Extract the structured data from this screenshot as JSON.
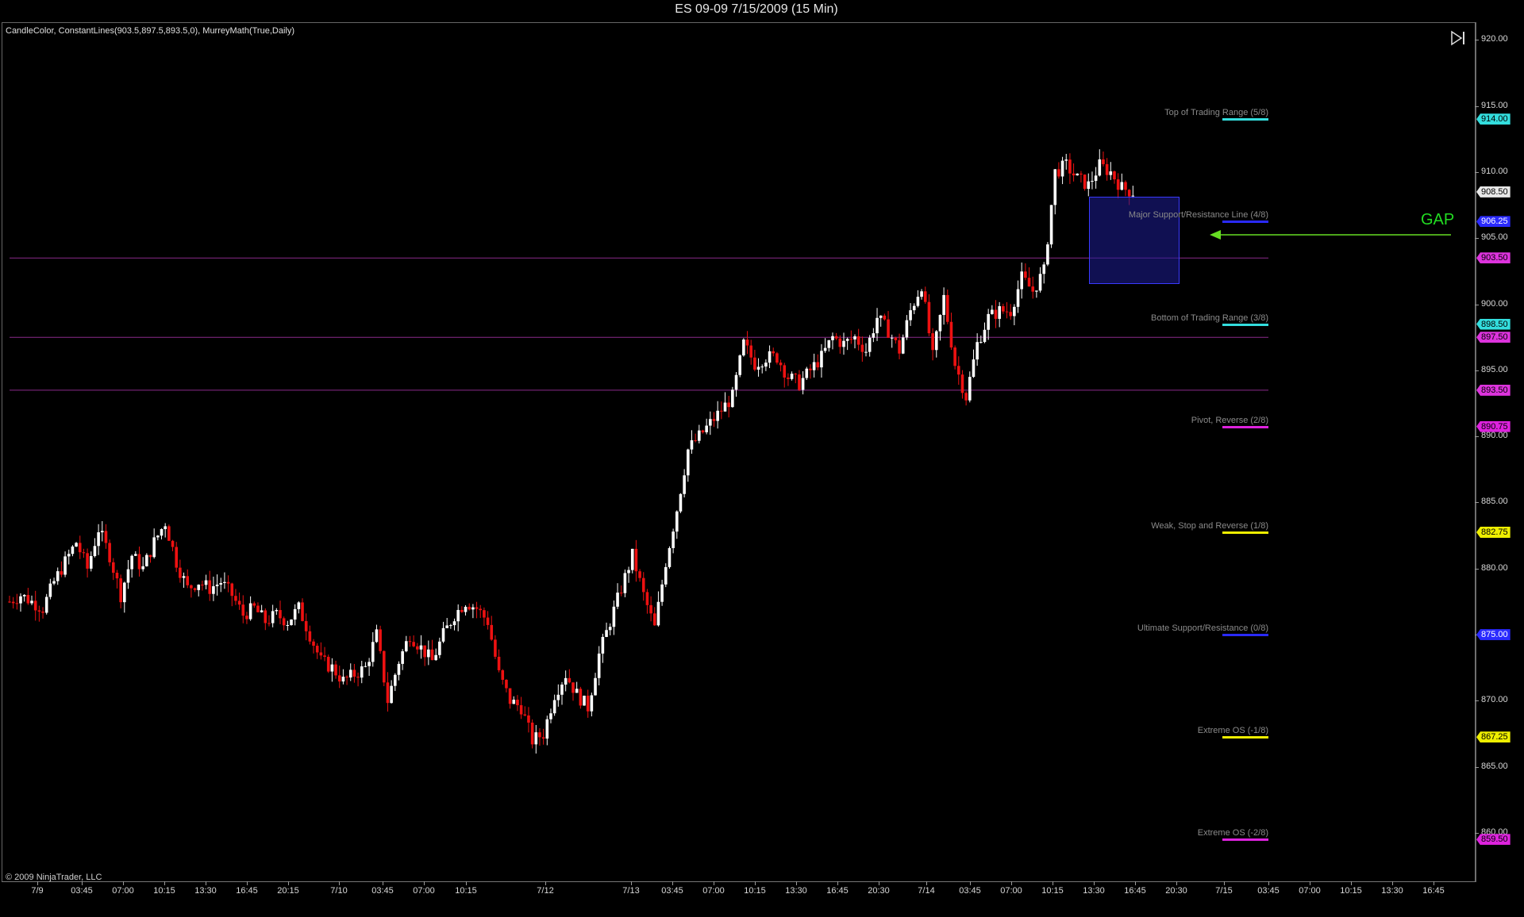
{
  "window": {
    "title": "ES 09-09  7/15/2009 (15 Min)",
    "indicators": "CandleColor, ConstantLines(903.5,897.5,893.5,0), MurreyMath(True,Daily)",
    "copyright": "© 2009 NinjaTrader, LLC",
    "gap_label": "GAP"
  },
  "icons": {
    "play_end": "skip-to-end-icon"
  },
  "colors": {
    "up_candle": "#ffffff",
    "down_candle": "#ee1111",
    "constant_line": "#8a2a8a",
    "gap_arrow": "#66dd22",
    "gap_text": "#22dd22",
    "gap_box": "#1e1e96"
  },
  "y_axis": {
    "labels": [
      "920.00",
      "915.00",
      "910.00",
      "905.00",
      "900.00",
      "895.00",
      "890.00",
      "885.00",
      "880.00",
      "875.00",
      "870.00",
      "865.00",
      "860.00"
    ],
    "range": [
      858.5,
      920.5
    ]
  },
  "x_axis": {
    "labels": [
      "7/9",
      "03:45",
      "07:00",
      "10:15",
      "13:30",
      "16:45",
      "20:15",
      "7/10",
      "03:45",
      "07:00",
      "10:15",
      "7/12",
      "7/13",
      "03:45",
      "07:00",
      "10:15",
      "13:30",
      "16:45",
      "20:30",
      "7/14",
      "03:45",
      "07:00",
      "10:15",
      "13:30",
      "16:45",
      "20:30",
      "7/15",
      "03:45",
      "07:00",
      "10:15",
      "13:30",
      "16:45"
    ]
  },
  "murrey_levels": [
    {
      "label": "Top of Trading Range (5/8)",
      "price": "914.00",
      "value": 914.0,
      "color": "#33dddd"
    },
    {
      "label": "Major Support/Resistance Line (4/8)",
      "price": "906.25",
      "value": 906.25,
      "color": "#2a2aff"
    },
    {
      "label": "Bottom of Trading Range (3/8)",
      "price": "898.50",
      "value": 898.5,
      "color": "#33dddd"
    },
    {
      "label": "Pivot, Reverse (2/8)",
      "price": "890.75",
      "value": 890.75,
      "color": "#dd22dd"
    },
    {
      "label": "Weak, Stop and Reverse (1/8)",
      "price": "882.75",
      "value": 882.75,
      "color": "#eeee00"
    },
    {
      "label": "Ultimate Support/Resistance (0/8)",
      "price": "875.00",
      "value": 875.0,
      "color": "#2a2aff"
    },
    {
      "label": "Extreme OS (-1/8)",
      "price": "867.25",
      "value": 867.25,
      "color": "#eeee00"
    },
    {
      "label": "Extreme OS (-2/8)",
      "price": "859.50",
      "value": 859.5,
      "color": "#dd22dd"
    }
  ],
  "constant_lines": [
    {
      "price": "903.50",
      "value": 903.5
    },
    {
      "price": "897.50",
      "value": 897.5
    },
    {
      "price": "893.50",
      "value": 893.5
    }
  ],
  "last_price": {
    "price": "908.50",
    "value": 908.5
  },
  "chart_data": {
    "type": "candlestick",
    "title": "ES 09-09  7/15/2009 (15 Min)",
    "ylim": [
      858.5,
      920.5
    ],
    "path_close": [
      [
        0,
        877.5
      ],
      [
        3,
        878.0
      ],
      [
        6,
        877.5
      ],
      [
        9,
        877.0
      ],
      [
        12,
        879.0
      ],
      [
        15,
        880.5
      ],
      [
        18,
        882.0
      ],
      [
        21,
        880.0
      ],
      [
        24,
        883.0
      ],
      [
        27,
        881.0
      ],
      [
        30,
        878.0
      ],
      [
        33,
        881.0
      ],
      [
        36,
        880.0
      ],
      [
        39,
        882.0
      ],
      [
        42,
        883.5
      ],
      [
        45,
        880.5
      ],
      [
        48,
        878.5
      ],
      [
        51,
        879.0
      ],
      [
        54,
        878.5
      ],
      [
        57,
        879.0
      ],
      [
        60,
        878.0
      ],
      [
        63,
        876.5
      ],
      [
        66,
        877.0
      ],
      [
        69,
        876.0
      ],
      [
        72,
        876.5
      ],
      [
        75,
        876.0
      ],
      [
        78,
        877.0
      ],
      [
        81,
        875.0
      ],
      [
        84,
        873.0
      ],
      [
        87,
        872.5
      ],
      [
        90,
        871.5
      ],
      [
        93,
        872.0
      ],
      [
        96,
        872.5
      ],
      [
        99,
        875.0
      ],
      [
        102,
        870.0
      ],
      [
        105,
        873.0
      ],
      [
        108,
        875.0
      ],
      [
        111,
        874.0
      ],
      [
        114,
        873.0
      ],
      [
        117,
        875.0
      ],
      [
        120,
        876.5
      ],
      [
        123,
        877.5
      ],
      [
        126,
        877.0
      ],
      [
        129,
        876.0
      ],
      [
        132,
        872.0
      ],
      [
        135,
        870.0
      ],
      [
        138,
        869.5
      ],
      [
        141,
        867.0
      ],
      [
        144,
        867.5
      ],
      [
        147,
        870.5
      ],
      [
        150,
        872.0
      ],
      [
        153,
        870.5
      ],
      [
        156,
        869.5
      ],
      [
        159,
        873.5
      ],
      [
        162,
        876.0
      ],
      [
        165,
        878.5
      ],
      [
        168,
        881.0
      ],
      [
        171,
        878.0
      ],
      [
        174,
        875.5
      ],
      [
        177,
        880.5
      ],
      [
        180,
        884.5
      ],
      [
        183,
        889.0
      ],
      [
        186,
        890.0
      ],
      [
        189,
        891.0
      ],
      [
        192,
        892.0
      ],
      [
        195,
        893.0
      ],
      [
        198,
        897.0
      ],
      [
        201,
        895.5
      ],
      [
        204,
        896.0
      ],
      [
        207,
        896.0
      ],
      [
        210,
        894.5
      ],
      [
        213,
        894.0
      ],
      [
        216,
        895.0
      ],
      [
        219,
        896.0
      ],
      [
        222,
        897.5
      ],
      [
        225,
        897.0
      ],
      [
        228,
        897.5
      ],
      [
        231,
        896.5
      ],
      [
        234,
        899.0
      ],
      [
        237,
        898.0
      ],
      [
        240,
        896.5
      ],
      [
        243,
        899.5
      ],
      [
        246,
        901.5
      ],
      [
        249,
        896.0
      ],
      [
        252,
        900.5
      ],
      [
        255,
        895.5
      ],
      [
        258,
        893.0
      ],
      [
        261,
        897.0
      ],
      [
        264,
        899.0
      ],
      [
        267,
        899.5
      ],
      [
        270,
        899.5
      ],
      [
        273,
        902.0
      ],
      [
        276,
        901.0
      ],
      [
        279,
        902.5
      ],
      [
        282,
        910.0
      ],
      [
        285,
        910.5
      ],
      [
        288,
        909.5
      ],
      [
        291,
        909.0
      ],
      [
        294,
        910.5
      ],
      [
        297,
        910.0
      ],
      [
        300,
        908.8
      ],
      [
        303,
        908.5
      ]
    ]
  }
}
